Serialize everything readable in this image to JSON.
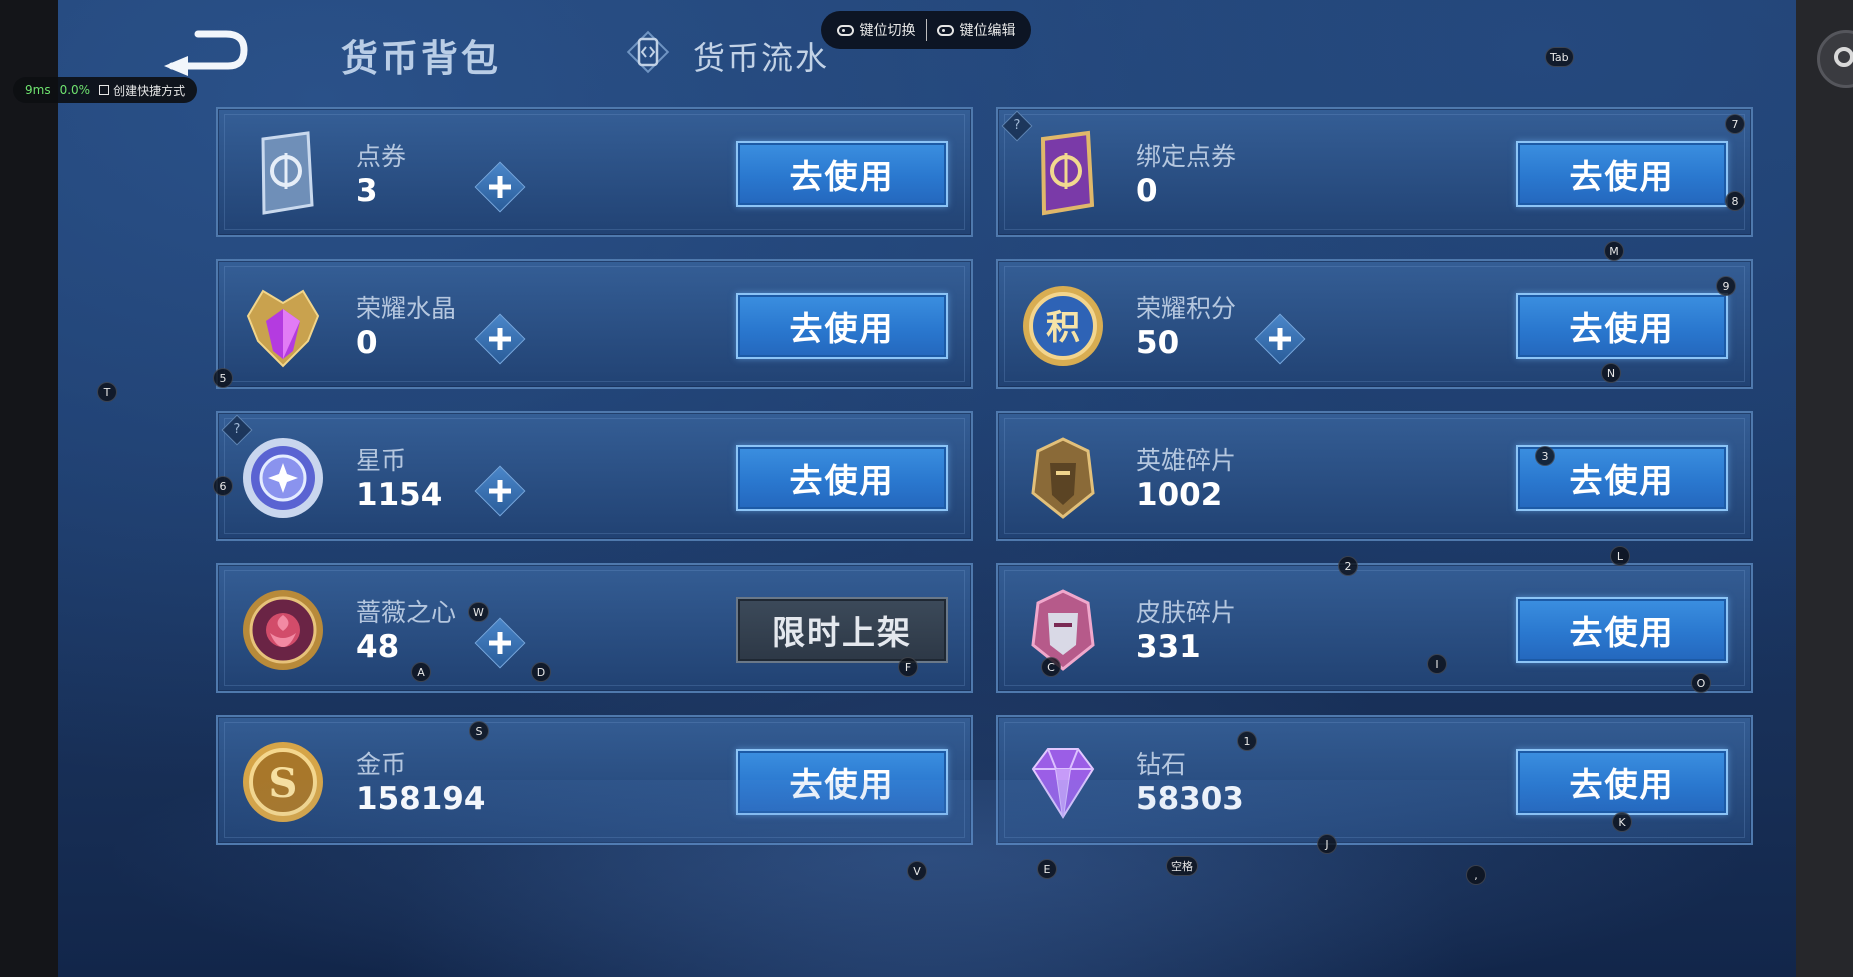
{
  "header": {
    "tab_active": "货币背包",
    "tab_flow": "货币流水"
  },
  "keymap_toolbar": {
    "switch_label": "键位切换",
    "edit_label": "键位编辑"
  },
  "perf": {
    "latency": "9ms",
    "loss": "0.0%",
    "shortcut_label": "创建快捷方式"
  },
  "cards": [
    {
      "name": "点券",
      "value": "3",
      "button": "去使用",
      "plus": true,
      "help": false,
      "icon": "voucher-icon"
    },
    {
      "name": "绑定点券",
      "value": "0",
      "button": "去使用",
      "plus": false,
      "help": true,
      "icon": "bound-voucher-icon"
    },
    {
      "name": "荣耀水晶",
      "value": "0",
      "button": "去使用",
      "plus": true,
      "help": false,
      "icon": "glory-crystal-icon"
    },
    {
      "name": "荣耀积分",
      "value": "50",
      "button": "去使用",
      "plus": true,
      "help": false,
      "icon": "glory-points-icon"
    },
    {
      "name": "星币",
      "value": "1154",
      "button": "去使用",
      "plus": true,
      "help": true,
      "icon": "star-coin-icon"
    },
    {
      "name": "英雄碎片",
      "value": "1002",
      "button": "去使用",
      "plus": false,
      "help": false,
      "icon": "hero-shard-icon"
    },
    {
      "name": "蔷薇之心",
      "value": "48",
      "button": "限时上架",
      "plus": true,
      "help": false,
      "icon": "rose-heart-icon"
    },
    {
      "name": "皮肤碎片",
      "value": "331",
      "button": "去使用",
      "plus": false,
      "help": false,
      "icon": "skin-shard-icon"
    },
    {
      "name": "金币",
      "value": "158194",
      "button": "去使用",
      "plus": false,
      "help": false,
      "icon": "gold-coin-icon"
    },
    {
      "name": "钻石",
      "value": "58303",
      "button": "去使用",
      "plus": false,
      "help": false,
      "icon": "diamond-icon"
    }
  ],
  "help_mark": "?",
  "key_markers": [
    "Tab",
    "7",
    "8",
    "M",
    "9",
    "N",
    "5",
    "T",
    "6",
    "3",
    "L",
    "2",
    "W",
    "F",
    "C",
    "I",
    "O",
    "A",
    "D",
    "S",
    "1",
    "J",
    "K",
    "V",
    "E",
    "空格",
    ","
  ]
}
